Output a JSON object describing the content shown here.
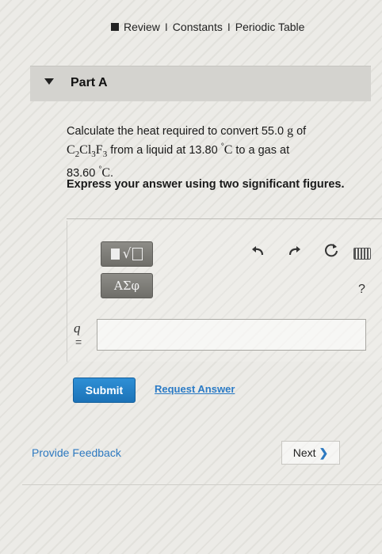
{
  "links": {
    "review": "Review",
    "sep1": "I",
    "constants": "Constants",
    "sep2": "I",
    "periodic_table": "Periodic Table"
  },
  "part": {
    "title": "Part A"
  },
  "question": {
    "text1": "Calculate the heat required to convert 55.0 ",
    "unit_g": "g",
    "text2": " of",
    "formula_c": "C",
    "sub_c": "2",
    "formula_cl": "Cl",
    "sub_cl": "3",
    "formula_f": "F",
    "sub_f": "3",
    "text3": " from a liquid at 13.80 ",
    "deg1": "°",
    "unit_c1": "C",
    "text4": " to a gas at",
    "text5": "83.60 ",
    "deg2": "°",
    "unit_c2": "C",
    "period": "."
  },
  "instruction": "Express your answer using two significant figures.",
  "toolbar": {
    "greek_label": "ΑΣφ",
    "help_label": "?",
    "sqrt_glyph": "√"
  },
  "answer": {
    "variable": "q",
    "equals": "=",
    "value": ""
  },
  "actions": {
    "submit": "Submit",
    "request_answer": "Request Answer"
  },
  "footer": {
    "feedback": "Provide Feedback",
    "next": "Next",
    "next_chevron": "❯"
  }
}
